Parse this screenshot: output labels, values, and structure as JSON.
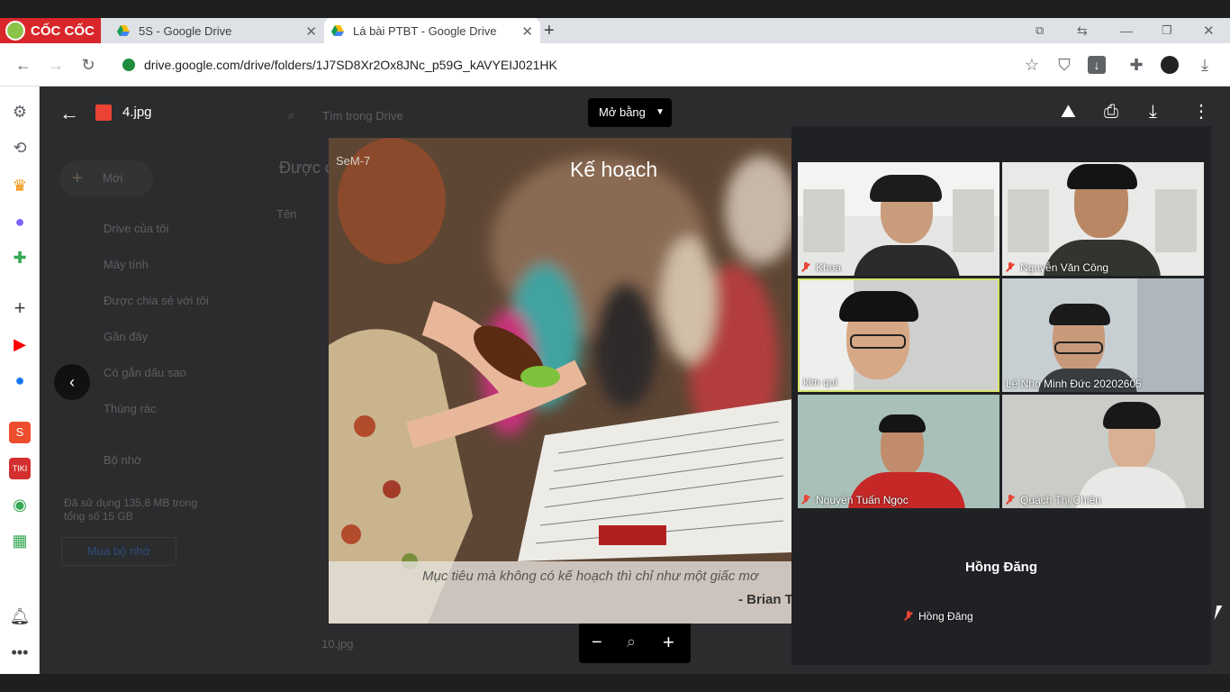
{
  "browser": {
    "brand": "CỐC CỐC",
    "tabs": [
      {
        "title": "5S - Google Drive",
        "active": false
      },
      {
        "title": "Lá bài PTBT - Google Drive",
        "active": true
      }
    ],
    "url": "drive.google.com/drive/folders/1J7SD8Xr2Ox8JNc_p59G_kAVYEIJ021HK"
  },
  "drive": {
    "search_placeholder": "Tìm trong Drive",
    "new_button": "Mới",
    "nav": [
      "Drive của tôi",
      "Máy tính",
      "Được chia sẻ với tôi",
      "Gần đây",
      "Có gắn dấu sao",
      "Thùng rác",
      "Bộ nhớ"
    ],
    "storage_text": "Đã sử dụng 135,8 MB trong tổng số 15 GB",
    "buy_storage": "Mua bộ nhớ",
    "section_title": "Được c",
    "sort_label": "Tên",
    "last_file": "10.jpg"
  },
  "viewer": {
    "file_name": "4.jpg",
    "open_with": "Mở bằng",
    "image": {
      "watermark": "SeM-7",
      "title": "Kế hoạch",
      "quote": "Mục tiêu mà không có kế hoạch thì chỉ như một giấc mơ",
      "author": "- Brian T"
    }
  },
  "meet": {
    "participants": [
      {
        "name": "Khoa",
        "muted": true
      },
      {
        "name": "Nguyễn Văn Công",
        "muted": true
      },
      {
        "name": "kim qui",
        "muted": false,
        "speaking": true
      },
      {
        "name": "Lê Nho Minh Đức 20202605",
        "muted": false
      },
      {
        "name": "Nguyễn Tuấn Ngọc",
        "muted": true
      },
      {
        "name": "Quách Thị Chiên",
        "muted": true
      }
    ],
    "presenter_tile": {
      "label": "Hồng Đăng",
      "name": "Hồng Đăng",
      "muted": true
    }
  },
  "colors": {
    "accent_yellow": "#d7e36b",
    "mute_red": "#ea4335",
    "cococ_red": "#d9262a"
  }
}
